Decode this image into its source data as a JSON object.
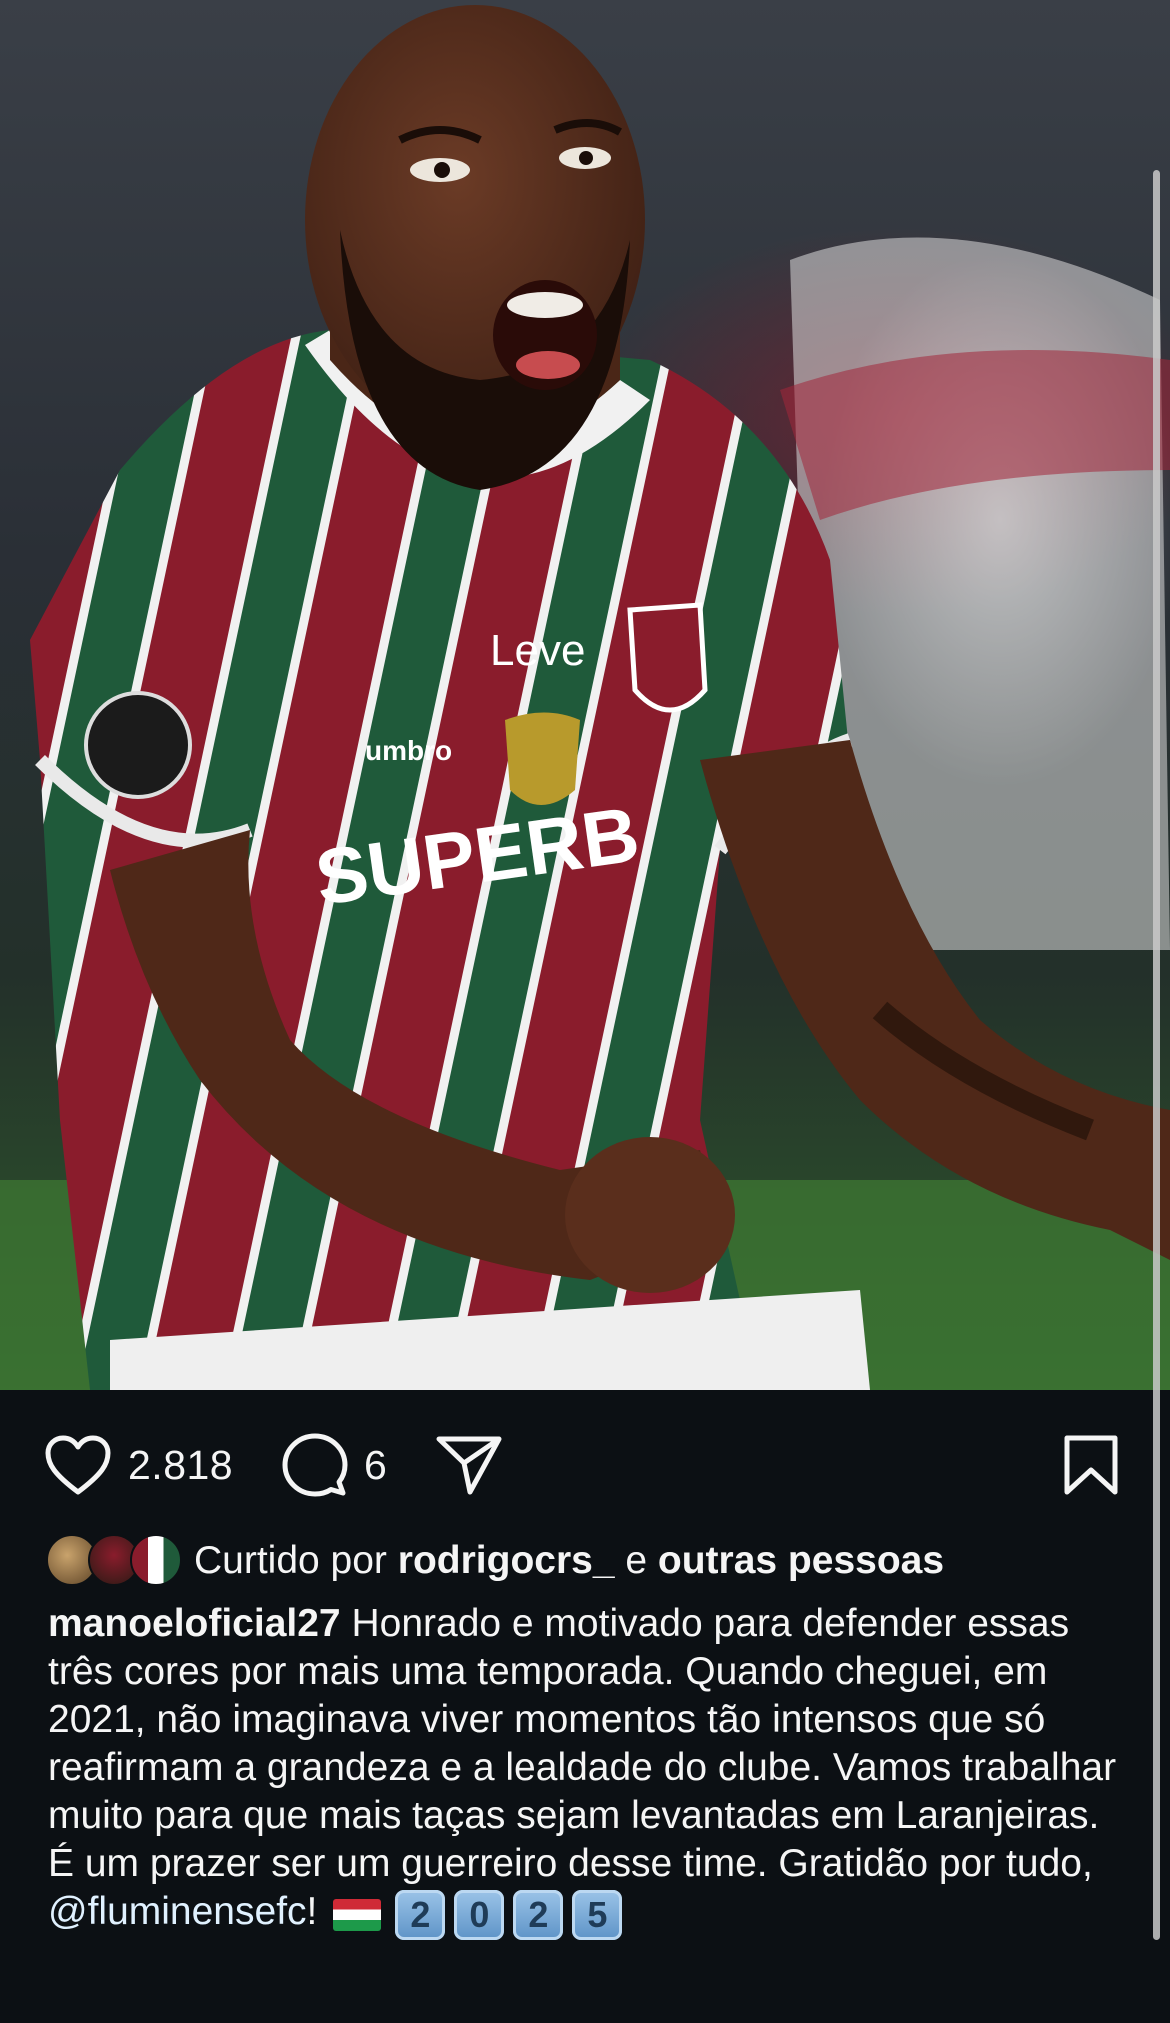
{
  "post": {
    "image_description_icon": "photo",
    "likes_count": "2.818",
    "comments_count": "6",
    "liked_by_prefix": "Curtido por",
    "liked_by_user": "rodrigocrs_",
    "liked_by_and": "e",
    "liked_by_others": "outras pessoas",
    "caption_username": "manoeloficial27",
    "caption_text": "Honrado e motivado para defender essas três cores por mais uma temporada. Quando cheguei, em 2021, não imaginava viver momentos tão intensos que só reafirmam a grandeza e a lealdade do clube. Vamos trabalhar muito para que mais taças sejam levantadas em Laranjeiras. É um prazer ser um guerreiro desse time. Gratidão por tudo,",
    "caption_mention": "@fluminensefc",
    "caption_mention_suffix": "!",
    "year_keycaps": [
      "2",
      "0",
      "2",
      "5"
    ]
  },
  "icons": {
    "like": "heart-icon",
    "comment": "comment-bubble-icon",
    "share": "paper-plane-icon",
    "save": "bookmark-icon"
  },
  "colors": {
    "background": "#0c1014",
    "text": "#f5f5f5",
    "jersey_maroon": "#8a1c2c",
    "jersey_green": "#1f5a3a",
    "mention": "#e0f1ff"
  }
}
